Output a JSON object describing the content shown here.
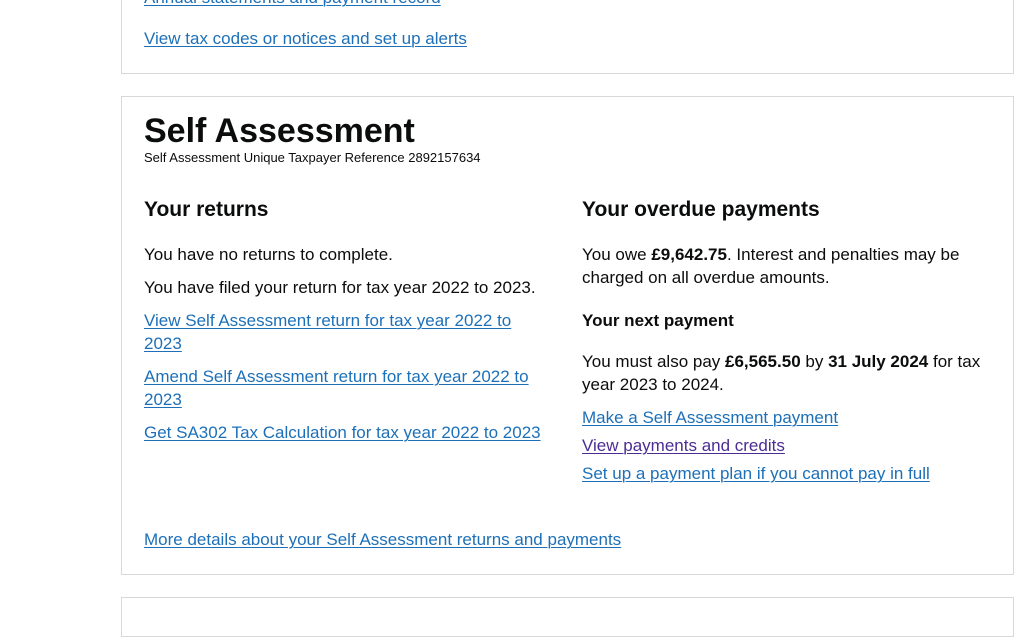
{
  "top_card": {
    "link_annual": "Annual statements and payment record",
    "link_tax_codes": "View tax codes or notices and set up alerts"
  },
  "self_assessment": {
    "title": "Self Assessment",
    "utr_label": "Self Assessment Unique Taxpayer Reference 2892157634",
    "returns": {
      "heading": "Your returns",
      "no_returns": "You have no returns to complete.",
      "filed": "You have filed your return for tax year 2022 to 2023.",
      "link_view": "View Self Assessment return for tax year 2022 to 2023",
      "link_amend": "Amend Self Assessment return for tax year 2022 to 2023",
      "link_sa302": "Get SA302 Tax Calculation for tax year 2022 to 2023"
    },
    "overdue": {
      "heading": "Your overdue payments",
      "owe_prefix": "You owe ",
      "owe_amount": "£9,642.75",
      "owe_suffix": ". Interest and penalties may be charged on all overdue amounts.",
      "next_heading": "Your next payment",
      "next_prefix": "You must also pay ",
      "next_amount": "£6,565.50",
      "next_by": " by ",
      "next_date": "31 July 2024",
      "next_suffix": " for tax year 2023 to 2024.",
      "link_make_payment": "Make a Self Assessment payment",
      "link_view_payments": "View payments and credits",
      "link_payment_plan": "Set up a payment plan if you cannot pay in full"
    },
    "link_more_details": "More details about your Self Assessment returns and payments"
  },
  "colors": {
    "link": "#1d70b8",
    "visited_link": "#4c2c92",
    "text": "#0b0c0c",
    "card_border": "#d8d8d8"
  }
}
